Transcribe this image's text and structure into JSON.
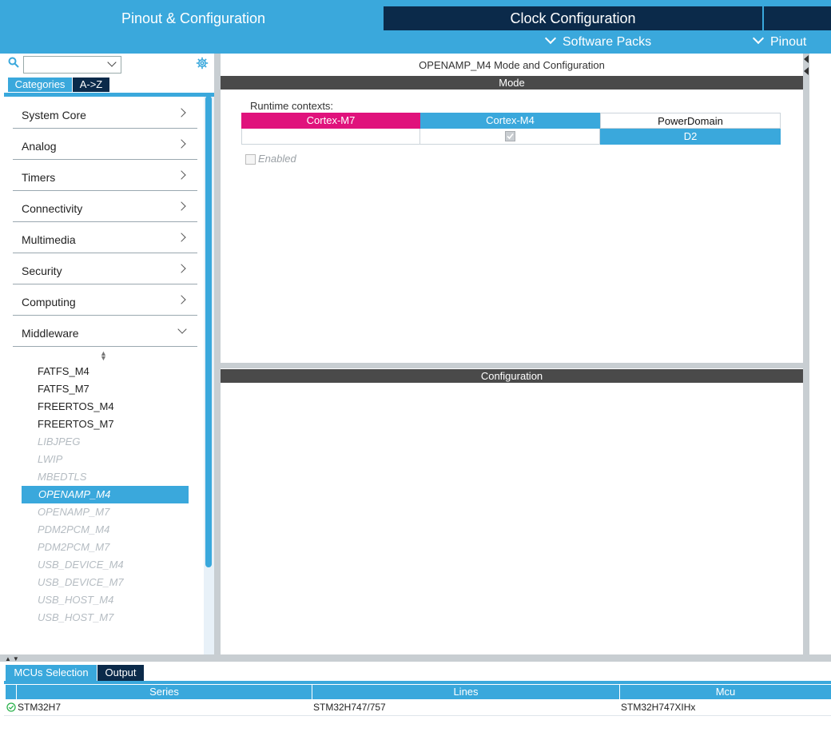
{
  "colors": {
    "accent": "#3aa8dc",
    "dark": "#0b2a4a",
    "magenta": "#e0127c",
    "header_bar": "#4a4a4a"
  },
  "tabs": {
    "pinout": "Pinout & Configuration",
    "clock": "Clock Configuration",
    "software_packs": "Software Packs",
    "pinout_menu": "Pinout"
  },
  "left": {
    "search": {
      "icon": "search-icon",
      "value": ""
    },
    "settings_icon": "gear-icon",
    "view_buttons": {
      "categories": "Categories",
      "az": "A->Z"
    },
    "categories": [
      {
        "label": "System Core",
        "expanded": false
      },
      {
        "label": "Analog",
        "expanded": false
      },
      {
        "label": "Timers",
        "expanded": false
      },
      {
        "label": "Connectivity",
        "expanded": false
      },
      {
        "label": "Multimedia",
        "expanded": false
      },
      {
        "label": "Security",
        "expanded": false
      },
      {
        "label": "Computing",
        "expanded": false
      },
      {
        "label": "Middleware",
        "expanded": true
      }
    ],
    "middleware_items": [
      {
        "label": "FATFS_M4",
        "state": "enabled"
      },
      {
        "label": "FATFS_M7",
        "state": "enabled"
      },
      {
        "label": "FREERTOS_M4",
        "state": "enabled"
      },
      {
        "label": "FREERTOS_M7",
        "state": "enabled"
      },
      {
        "label": "LIBJPEG",
        "state": "disabled"
      },
      {
        "label": "LWIP",
        "state": "disabled"
      },
      {
        "label": "MBEDTLS",
        "state": "disabled"
      },
      {
        "label": "OPENAMP_M4",
        "state": "selected"
      },
      {
        "label": "OPENAMP_M7",
        "state": "disabled"
      },
      {
        "label": "PDM2PCM_M4",
        "state": "disabled"
      },
      {
        "label": "PDM2PCM_M7",
        "state": "disabled"
      },
      {
        "label": "USB_DEVICE_M4",
        "state": "disabled"
      },
      {
        "label": "USB_DEVICE_M7",
        "state": "disabled"
      },
      {
        "label": "USB_HOST_M4",
        "state": "disabled"
      },
      {
        "label": "USB_HOST_M7",
        "state": "disabled"
      }
    ]
  },
  "mode": {
    "title": "OPENAMP_M4 Mode and Configuration",
    "header": "Mode",
    "runtime_label": "Runtime contexts:",
    "contexts": {
      "cortex_m7": "Cortex-M7",
      "cortex_m4": "Cortex-M4",
      "power_domain": "PowerDomain",
      "m4_checked": true,
      "power_value": "D2"
    },
    "enabled_label": "Enabled",
    "enabled_checked": false
  },
  "configuration": {
    "header": "Configuration"
  },
  "bottom": {
    "tabs": {
      "mcus": "MCUs Selection",
      "output": "Output"
    },
    "columns": [
      "Series",
      "Lines",
      "Mcu"
    ],
    "rows": [
      {
        "series": "STM32H7",
        "lines": "STM32H747/757",
        "mcu": "STM32H747XIHx",
        "status_icon": "check-circle-icon"
      }
    ]
  }
}
